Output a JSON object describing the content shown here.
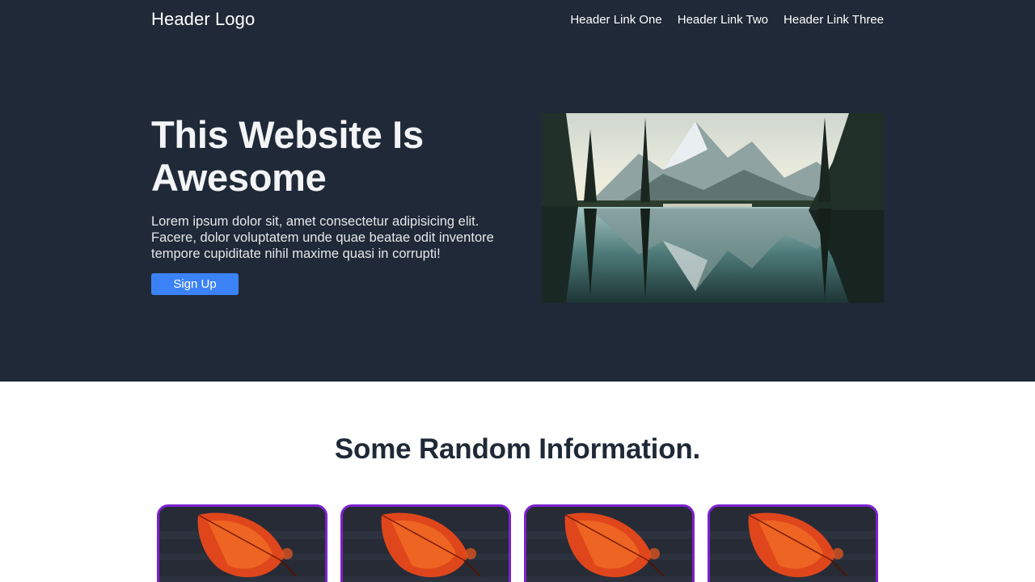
{
  "header": {
    "logo": "Header Logo",
    "links": [
      {
        "label": "Header Link One"
      },
      {
        "label": "Header Link Two"
      },
      {
        "label": "Header Link Three"
      }
    ]
  },
  "hero": {
    "title": "This Website Is Awesome",
    "description": "Lorem ipsum dolor sit, amet consectetur adipisicing elit. Facere, dolor voluptatem unde quae beatae odit inventore tempore cupiditate nihil maxime quasi in corrupti!",
    "cta_label": "Sign Up"
  },
  "info": {
    "title": "Some Random Information."
  },
  "colors": {
    "hero_bg": "#1f2937",
    "accent": "#3b82f6",
    "card_border": "#7e22ce"
  }
}
